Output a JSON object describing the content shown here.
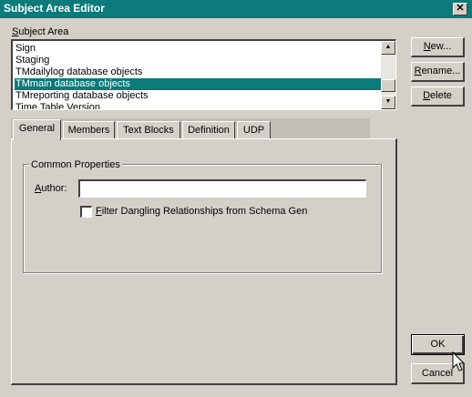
{
  "window": {
    "title": "Subject Area Editor",
    "close_glyph": "✕"
  },
  "subject_area": {
    "label": "Subject Area",
    "items": [
      {
        "text": "Sign"
      },
      {
        "text": "Staging"
      },
      {
        "text": "TMdailylog database objects"
      },
      {
        "text": "TMmain database objects",
        "selected": true
      },
      {
        "text": "TMreporting database objects"
      },
      {
        "text": "Time Table Version"
      }
    ]
  },
  "buttons": {
    "new": "New...",
    "rename": "Rename...",
    "delete": "Delete",
    "ok": "OK",
    "cancel": "Cancel"
  },
  "tabs": [
    {
      "label": "General",
      "active": true
    },
    {
      "label": "Members"
    },
    {
      "label": "Text Blocks"
    },
    {
      "label": "Definition"
    },
    {
      "label": "UDP"
    }
  ],
  "general": {
    "group_title": "Common Properties",
    "author_label": "Author:",
    "author_value": "",
    "filter_label": "Filter Dangling Relationships from Schema Gen",
    "filter_checked": false
  },
  "colors": {
    "title_bar": "#0a7a7a",
    "selection": "#0a7a7a",
    "dialog_bg": "#d4d0c8"
  },
  "icons": {
    "scroll_up": "▲",
    "scroll_down": "▼",
    "cursor": "mouse-pointer-icon"
  }
}
